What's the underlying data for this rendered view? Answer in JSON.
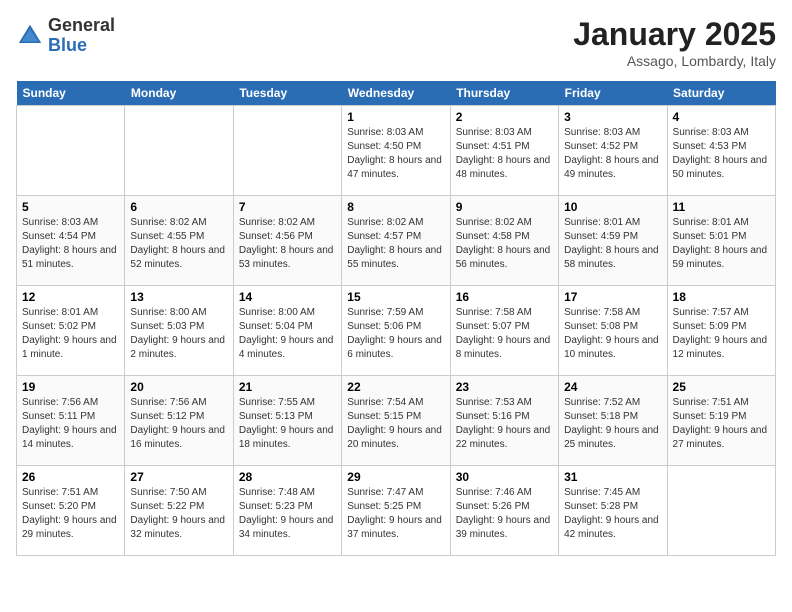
{
  "header": {
    "logo_general": "General",
    "logo_blue": "Blue",
    "month_title": "January 2025",
    "location": "Assago, Lombardy, Italy"
  },
  "weekdays": [
    "Sunday",
    "Monday",
    "Tuesday",
    "Wednesday",
    "Thursday",
    "Friday",
    "Saturday"
  ],
  "weeks": [
    [
      {
        "day": "",
        "sunrise": "",
        "sunset": "",
        "daylight": ""
      },
      {
        "day": "",
        "sunrise": "",
        "sunset": "",
        "daylight": ""
      },
      {
        "day": "",
        "sunrise": "",
        "sunset": "",
        "daylight": ""
      },
      {
        "day": "1",
        "sunrise": "Sunrise: 8:03 AM",
        "sunset": "Sunset: 4:50 PM",
        "daylight": "Daylight: 8 hours and 47 minutes."
      },
      {
        "day": "2",
        "sunrise": "Sunrise: 8:03 AM",
        "sunset": "Sunset: 4:51 PM",
        "daylight": "Daylight: 8 hours and 48 minutes."
      },
      {
        "day": "3",
        "sunrise": "Sunrise: 8:03 AM",
        "sunset": "Sunset: 4:52 PM",
        "daylight": "Daylight: 8 hours and 49 minutes."
      },
      {
        "day": "4",
        "sunrise": "Sunrise: 8:03 AM",
        "sunset": "Sunset: 4:53 PM",
        "daylight": "Daylight: 8 hours and 50 minutes."
      }
    ],
    [
      {
        "day": "5",
        "sunrise": "Sunrise: 8:03 AM",
        "sunset": "Sunset: 4:54 PM",
        "daylight": "Daylight: 8 hours and 51 minutes."
      },
      {
        "day": "6",
        "sunrise": "Sunrise: 8:02 AM",
        "sunset": "Sunset: 4:55 PM",
        "daylight": "Daylight: 8 hours and 52 minutes."
      },
      {
        "day": "7",
        "sunrise": "Sunrise: 8:02 AM",
        "sunset": "Sunset: 4:56 PM",
        "daylight": "Daylight: 8 hours and 53 minutes."
      },
      {
        "day": "8",
        "sunrise": "Sunrise: 8:02 AM",
        "sunset": "Sunset: 4:57 PM",
        "daylight": "Daylight: 8 hours and 55 minutes."
      },
      {
        "day": "9",
        "sunrise": "Sunrise: 8:02 AM",
        "sunset": "Sunset: 4:58 PM",
        "daylight": "Daylight: 8 hours and 56 minutes."
      },
      {
        "day": "10",
        "sunrise": "Sunrise: 8:01 AM",
        "sunset": "Sunset: 4:59 PM",
        "daylight": "Daylight: 8 hours and 58 minutes."
      },
      {
        "day": "11",
        "sunrise": "Sunrise: 8:01 AM",
        "sunset": "Sunset: 5:01 PM",
        "daylight": "Daylight: 8 hours and 59 minutes."
      }
    ],
    [
      {
        "day": "12",
        "sunrise": "Sunrise: 8:01 AM",
        "sunset": "Sunset: 5:02 PM",
        "daylight": "Daylight: 9 hours and 1 minute."
      },
      {
        "day": "13",
        "sunrise": "Sunrise: 8:00 AM",
        "sunset": "Sunset: 5:03 PM",
        "daylight": "Daylight: 9 hours and 2 minutes."
      },
      {
        "day": "14",
        "sunrise": "Sunrise: 8:00 AM",
        "sunset": "Sunset: 5:04 PM",
        "daylight": "Daylight: 9 hours and 4 minutes."
      },
      {
        "day": "15",
        "sunrise": "Sunrise: 7:59 AM",
        "sunset": "Sunset: 5:06 PM",
        "daylight": "Daylight: 9 hours and 6 minutes."
      },
      {
        "day": "16",
        "sunrise": "Sunrise: 7:58 AM",
        "sunset": "Sunset: 5:07 PM",
        "daylight": "Daylight: 9 hours and 8 minutes."
      },
      {
        "day": "17",
        "sunrise": "Sunrise: 7:58 AM",
        "sunset": "Sunset: 5:08 PM",
        "daylight": "Daylight: 9 hours and 10 minutes."
      },
      {
        "day": "18",
        "sunrise": "Sunrise: 7:57 AM",
        "sunset": "Sunset: 5:09 PM",
        "daylight": "Daylight: 9 hours and 12 minutes."
      }
    ],
    [
      {
        "day": "19",
        "sunrise": "Sunrise: 7:56 AM",
        "sunset": "Sunset: 5:11 PM",
        "daylight": "Daylight: 9 hours and 14 minutes."
      },
      {
        "day": "20",
        "sunrise": "Sunrise: 7:56 AM",
        "sunset": "Sunset: 5:12 PM",
        "daylight": "Daylight: 9 hours and 16 minutes."
      },
      {
        "day": "21",
        "sunrise": "Sunrise: 7:55 AM",
        "sunset": "Sunset: 5:13 PM",
        "daylight": "Daylight: 9 hours and 18 minutes."
      },
      {
        "day": "22",
        "sunrise": "Sunrise: 7:54 AM",
        "sunset": "Sunset: 5:15 PM",
        "daylight": "Daylight: 9 hours and 20 minutes."
      },
      {
        "day": "23",
        "sunrise": "Sunrise: 7:53 AM",
        "sunset": "Sunset: 5:16 PM",
        "daylight": "Daylight: 9 hours and 22 minutes."
      },
      {
        "day": "24",
        "sunrise": "Sunrise: 7:52 AM",
        "sunset": "Sunset: 5:18 PM",
        "daylight": "Daylight: 9 hours and 25 minutes."
      },
      {
        "day": "25",
        "sunrise": "Sunrise: 7:51 AM",
        "sunset": "Sunset: 5:19 PM",
        "daylight": "Daylight: 9 hours and 27 minutes."
      }
    ],
    [
      {
        "day": "26",
        "sunrise": "Sunrise: 7:51 AM",
        "sunset": "Sunset: 5:20 PM",
        "daylight": "Daylight: 9 hours and 29 minutes."
      },
      {
        "day": "27",
        "sunrise": "Sunrise: 7:50 AM",
        "sunset": "Sunset: 5:22 PM",
        "daylight": "Daylight: 9 hours and 32 minutes."
      },
      {
        "day": "28",
        "sunrise": "Sunrise: 7:48 AM",
        "sunset": "Sunset: 5:23 PM",
        "daylight": "Daylight: 9 hours and 34 minutes."
      },
      {
        "day": "29",
        "sunrise": "Sunrise: 7:47 AM",
        "sunset": "Sunset: 5:25 PM",
        "daylight": "Daylight: 9 hours and 37 minutes."
      },
      {
        "day": "30",
        "sunrise": "Sunrise: 7:46 AM",
        "sunset": "Sunset: 5:26 PM",
        "daylight": "Daylight: 9 hours and 39 minutes."
      },
      {
        "day": "31",
        "sunrise": "Sunrise: 7:45 AM",
        "sunset": "Sunset: 5:28 PM",
        "daylight": "Daylight: 9 hours and 42 minutes."
      },
      {
        "day": "",
        "sunrise": "",
        "sunset": "",
        "daylight": ""
      }
    ]
  ]
}
